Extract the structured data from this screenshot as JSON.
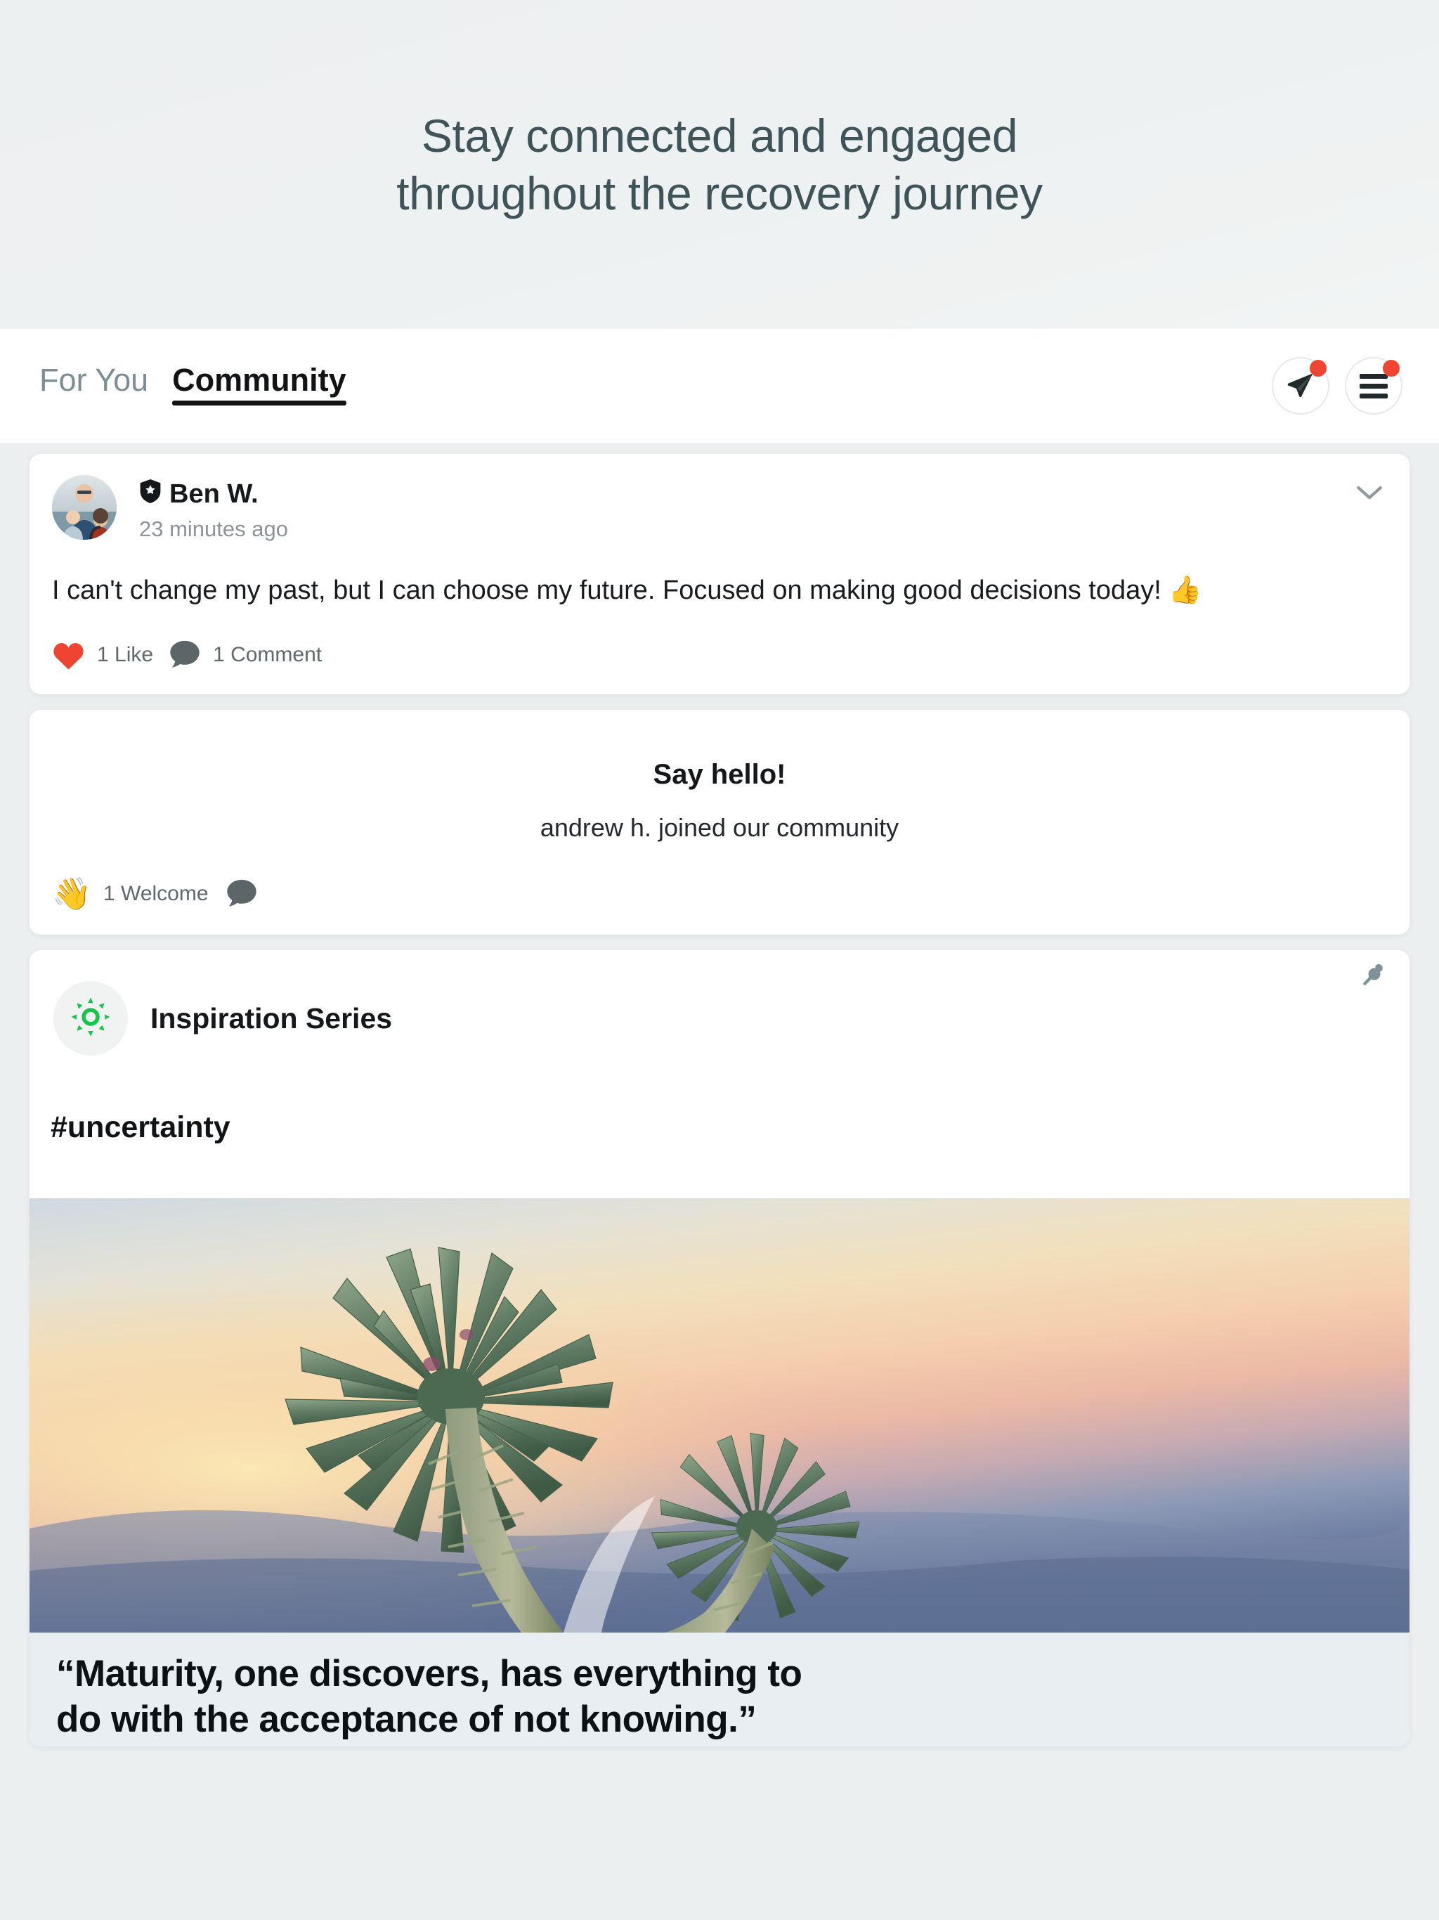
{
  "promo": {
    "headline_line1": "Stay connected and engaged",
    "headline_line2": "throughout the recovery journey",
    "text_color": "#3f5459"
  },
  "app_bar": {
    "tabs": [
      {
        "label": "For You",
        "active": false
      },
      {
        "label": "Community",
        "active": true
      }
    ],
    "actions": [
      {
        "name": "send-message",
        "icon": "paper-plane-icon",
        "has_badge": true
      },
      {
        "name": "menu",
        "icon": "hamburger-menu-icon",
        "has_badge": true
      }
    ],
    "badge_color": "#ef4432"
  },
  "feed": {
    "post": {
      "author": "Ben W.",
      "verified_icon": "shield-star-badge-icon",
      "timestamp": "23 minutes ago",
      "body": "I can't change my past, but I can choose my future. Focused on making good decisions today!",
      "body_emoji": "👍",
      "expand_icon": "chevron-down-icon",
      "reactions": [
        {
          "icon": "heart-icon",
          "label": "1 Like",
          "color": "#ef4432"
        },
        {
          "icon": "comment-bubble-icon",
          "label": "1 Comment",
          "color": "#5c6568"
        }
      ]
    },
    "join_card": {
      "title": "Say hello!",
      "subtitle": "andrew h. joined our community",
      "reactions": [
        {
          "icon": "waving-hand-emoji",
          "emoji": "👋",
          "label": "1 Welcome"
        },
        {
          "icon": "comment-bubble-icon",
          "label": "",
          "color": "#5c6568"
        }
      ]
    },
    "inspiration_card": {
      "avatar_icon": "green-sun-icon",
      "avatar_icon_color": "#17c44a",
      "title": "Inspiration Series",
      "pin_icon": "pushpin-icon",
      "pin_icon_color": "#7d939c",
      "hashtag": "#uncertainty",
      "media_alt": "desert-plant-at-sunset-photo",
      "quote_line1": "“Maturity, one discovers, has everything to",
      "quote_line2": "do with the acceptance of not knowing.”"
    }
  }
}
